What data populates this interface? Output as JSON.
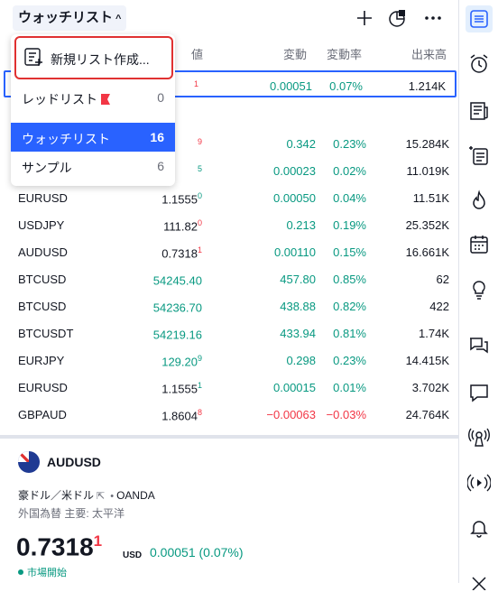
{
  "header": {
    "title": "ウォッチリスト",
    "chevron": "^"
  },
  "columns": {
    "last_partial": "値",
    "change": "変動",
    "change_pct": "変動率",
    "volume": "出来高"
  },
  "rows": [
    {
      "symbol": "",
      "last_main": "",
      "last_sup": "1",
      "change": "0.00051",
      "change_pct": "0.07%",
      "volume": "1.214K",
      "dir": "pos"
    },
    {
      "symbol": "",
      "last_main": "",
      "last_sup": "9",
      "change": "0.342",
      "change_pct": "0.23%",
      "volume": "15.284K",
      "dir": "pos"
    },
    {
      "symbol": "",
      "last_main": "",
      "last_sup": "5",
      "change": "0.00023",
      "change_pct": "0.02%",
      "volume": "11.019K",
      "dir": "pos"
    },
    {
      "symbol": "EURUSD",
      "last_main": "1.1555",
      "last_sup": "0",
      "change": "0.00050",
      "change_pct": "0.04%",
      "volume": "11.51K",
      "dir": "pos"
    },
    {
      "symbol": "USDJPY",
      "last_main": "111.82",
      "last_sup": "0",
      "change": "0.213",
      "change_pct": "0.19%",
      "volume": "25.352K",
      "dir": "pos"
    },
    {
      "symbol": "AUDUSD",
      "last_main": "0.7318",
      "last_sup": "1",
      "change": "0.00110",
      "change_pct": "0.15%",
      "volume": "16.661K",
      "dir": "pos"
    },
    {
      "symbol": "BTCUSD",
      "last_main": "54245.40",
      "last_sup": "",
      "change": "457.80",
      "change_pct": "0.85%",
      "volume": "62",
      "dir": "pos"
    },
    {
      "symbol": "BTCUSD",
      "last_main": "54236.70",
      "last_sup": "",
      "change": "438.88",
      "change_pct": "0.82%",
      "volume": "422",
      "dir": "pos"
    },
    {
      "symbol": "BTCUSDT",
      "last_main": "54219.16",
      "last_sup": "",
      "change": "433.94",
      "change_pct": "0.81%",
      "volume": "1.74K",
      "dir": "pos"
    },
    {
      "symbol": "EURJPY",
      "last_main": "129.20",
      "last_sup": "9",
      "change": "0.298",
      "change_pct": "0.23%",
      "volume": "14.415K",
      "dir": "pos"
    },
    {
      "symbol": "EURUSD",
      "last_main": "1.1555",
      "last_sup": "1",
      "change": "0.00015",
      "change_pct": "0.01%",
      "volume": "3.702K",
      "dir": "pos"
    },
    {
      "symbol": "GBPAUD",
      "last_main": "1.8604",
      "last_sup": "8",
      "change": "−0.00063",
      "change_pct": "−0.03%",
      "volume": "24.764K",
      "dir": "neg"
    }
  ],
  "dropdown": {
    "new_list": "新規リスト作成...",
    "items": [
      {
        "label": "レッドリスト",
        "count": "0"
      },
      {
        "label": "ウォッチリスト",
        "count": "16"
      },
      {
        "label": "サンプル",
        "count": "6"
      }
    ]
  },
  "detail": {
    "symbol": "AUDUSD",
    "name": "豪ドル／米ドル",
    "exchange": "OANDA",
    "sub": "外国為替 主要: 太平洋",
    "price_main": "0.7318",
    "price_sup": "1",
    "currency": "USD",
    "change": "0.00051 (0.07%)",
    "status": "市場開始"
  },
  "colors": {
    "accent": "#2962ff",
    "positive": "#089981",
    "negative": "#f23645",
    "highlight_box": "#e03131"
  }
}
